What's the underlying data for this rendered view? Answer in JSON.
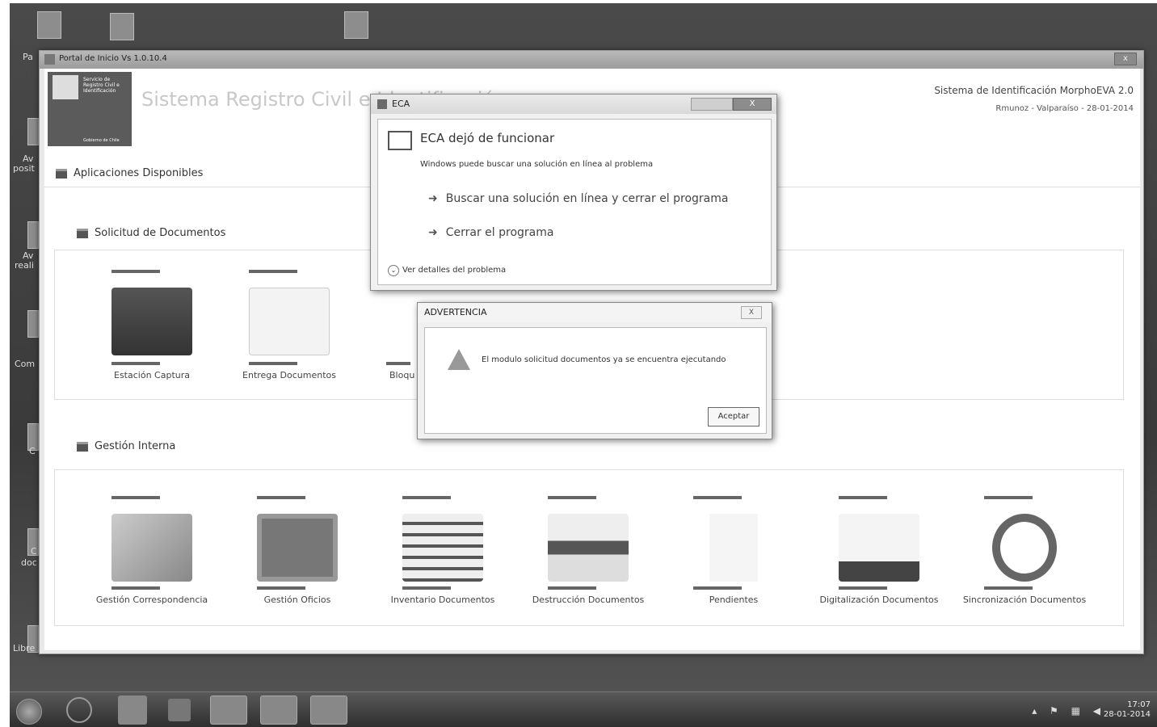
{
  "desktop": {
    "labels": [
      "Pa",
      "Av",
      "posit",
      "Av",
      "reali",
      "Com",
      "C",
      "C",
      "doc",
      "Libre"
    ]
  },
  "window": {
    "title": "Portal de Inicio Vs 1.0.10.4",
    "close": "x"
  },
  "header": {
    "logo_text": "Servicio de Registro Civil e Identificación",
    "logo_footer": "Gobierno de Chile",
    "app_title": "Sistema Registro Civil e Identificación",
    "system": "Sistema de Identificación MorphoEVA 2.0",
    "user_info": "Rmunoz - Valparaíso - 28-01-2014"
  },
  "main": {
    "available_title": "Aplicaciones Disponibles",
    "section1": {
      "title": "Solicitud de Documentos",
      "tiles": [
        {
          "label": "Estación Captura",
          "icon": "camera-pad-icon"
        },
        {
          "label": "Entrega Documentos",
          "icon": "document-icon"
        },
        {
          "label": "Bloqu",
          "icon": "lock-icon"
        }
      ]
    },
    "section2": {
      "title": "Gestión Interna",
      "tiles": [
        {
          "label": "Gestión Correspondencia",
          "icon": "envelope-icon"
        },
        {
          "label": "Gestión Oficios",
          "icon": "tray-icon"
        },
        {
          "label": "Inventario Documentos",
          "icon": "printer-icon"
        },
        {
          "label": "Destrucción Documentos",
          "icon": "shredder-icon"
        },
        {
          "label": "Pendientes",
          "icon": "hourglass-icon"
        },
        {
          "label": "Digitalización Documentos",
          "icon": "scanner-icon"
        },
        {
          "label": "Sincronización Documentos",
          "icon": "sync-icon"
        }
      ]
    }
  },
  "eca_dialog": {
    "title": "ECA",
    "heading": "ECA dejó de funcionar",
    "subtitle": "Windows puede buscar una solución en línea al problema",
    "action1": "Buscar una solución en línea y cerrar el programa",
    "action2": "Cerrar el programa",
    "details": "Ver detalles del problema",
    "close": "X"
  },
  "warning_dialog": {
    "title": "ADVERTENCIA",
    "message": "El modulo solicitud documentos ya se encuentra ejecutando",
    "accept": "Aceptar",
    "close": "X"
  },
  "taskbar": {
    "time": "17:07",
    "date": "28-01-2014"
  }
}
